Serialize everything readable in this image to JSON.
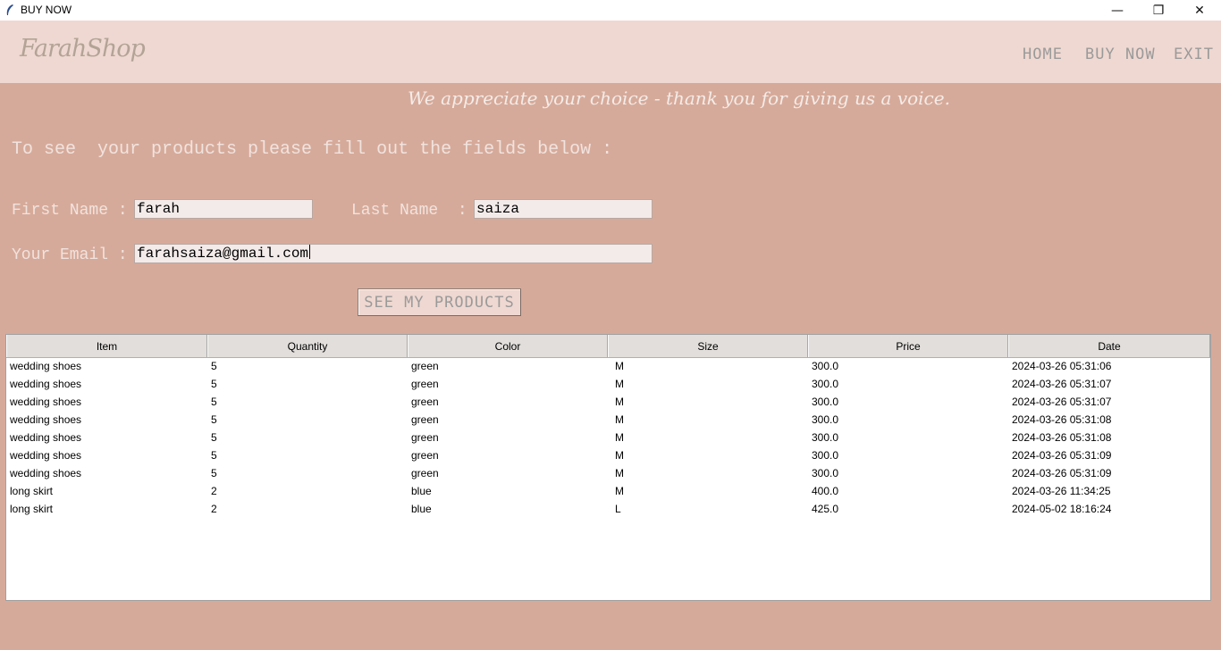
{
  "window": {
    "title": "BUY NOW",
    "minimize_glyph": "—",
    "restore_glyph": "❐",
    "close_glyph": "✕"
  },
  "header": {
    "logo": "FarahShop",
    "nav": {
      "home": "HOME",
      "buy_now": "BUY NOW",
      "exit": "EXIT"
    }
  },
  "tagline": "We appreciate your choice - thank you for giving us a voice.",
  "instructions": "To see  your products please fill out the fields below :",
  "form": {
    "first_name_label": "First Name :",
    "first_name_value": "farah",
    "last_name_label": "Last Name  :",
    "last_name_value": "saiza",
    "email_label": "Your Email :",
    "email_value": "farahsaiza@gmail.com",
    "submit_label": "SEE MY PRODUCTS"
  },
  "table": {
    "columns": [
      "Item",
      "Quantity",
      "Color",
      "Size",
      "Price",
      "Date"
    ],
    "rows": [
      [
        "wedding shoes",
        "5",
        "green",
        "M",
        "300.0",
        "2024-03-26 05:31:06"
      ],
      [
        "wedding shoes",
        "5",
        "green",
        "M",
        "300.0",
        "2024-03-26 05:31:07"
      ],
      [
        "wedding shoes",
        "5",
        "green",
        "M",
        "300.0",
        "2024-03-26 05:31:07"
      ],
      [
        "wedding shoes",
        "5",
        "green",
        "M",
        "300.0",
        "2024-03-26 05:31:08"
      ],
      [
        "wedding shoes",
        "5",
        "green",
        "M",
        "300.0",
        "2024-03-26 05:31:08"
      ],
      [
        "wedding shoes",
        "5",
        "green",
        "M",
        "300.0",
        "2024-03-26 05:31:09"
      ],
      [
        "wedding shoes",
        "5",
        "green",
        "M",
        "300.0",
        "2024-03-26 05:31:09"
      ],
      [
        "long skirt",
        "2",
        "blue",
        "M",
        "400.0",
        "2024-03-26 11:34:25"
      ],
      [
        "long skirt",
        "2",
        "blue",
        "L",
        "425.0",
        "2024-05-02 18:16:24"
      ]
    ]
  },
  "colors": {
    "background": "#d6aa9a",
    "header": "#efd8d1",
    "nav_text": "#9a9a9a"
  }
}
